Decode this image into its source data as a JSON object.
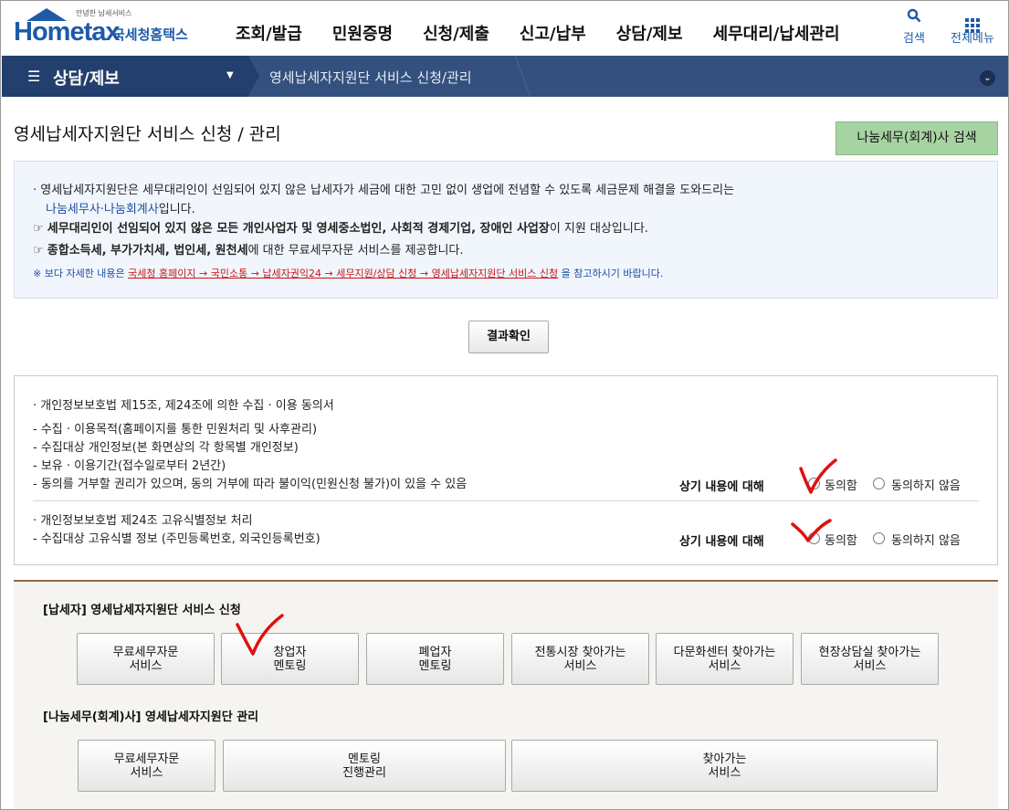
{
  "header": {
    "logo_small": "안녕한 납세서비스",
    "logo_text": "Hometax",
    "logo_sub": "국세청홈택스",
    "nav": [
      "조회/발급",
      "민원증명",
      "신청/제출",
      "신고/납부",
      "상담/제보",
      "세무대리/납세관리"
    ],
    "search_label": "검색",
    "menu_label": "전체메뉴"
  },
  "location": {
    "section": "상담/제보",
    "crumb": "영세납세자지원단 서비스 신청/관리"
  },
  "page": {
    "title": "영세납세자지원단 서비스 신청 / 관리",
    "search_button": "나눔세무(회계)사 검색"
  },
  "info": {
    "line1": "영세납세자지원단은 세무대리인이 선임되어 있지 않은 납세자가 세금에 대한 고민 없이 생업에 전념할 수 있도록 세금문제 해결을 도와드리는",
    "line1b_link": "나눔세무사·나눔회계사",
    "line1b_rest": "입니다.",
    "line2_bold1": "세무대리인이 선임되어 있지 않은 모든 개인사업자 및 영세중소법인, 사회적 경제기업, 장애인 사업장",
    "line2_rest": "이 지원 대상입니다.",
    "line3_bold": "종합소득세, 부가가치세, 법인세, 원천세",
    "line3_rest": "에 대한 무료세무자문 서비스를 제공합니다.",
    "note_prefix": "※ 보다 자세한 내용은",
    "note_link": "국세청 홈페이지 → 국민소통 → 납세자권익24 → 세무지원/상담 신청 → 영세납세자지원단 서비스 신청",
    "note_suffix": "을 참고하시기 바랍니다."
  },
  "result_button": "결과확인",
  "consent": {
    "block1": [
      "개인정보보호법 제15조,  제24조에 의한 수집 · 이용 동의서",
      "- 수집 · 이용목적(홈페이지를 통한 민원처리 및 사후관리)",
      "- 수집대상 개인정보(본 화면상의 각 항목별 개인정보)",
      "- 보유 · 이용기간(접수일로부터 2년간)",
      "- 동의를 거부할 권리가 있으며, 동의 거부에 따라 불이익(민원신청 불가)이 있을 수 있음"
    ],
    "block2": [
      "개인정보보호법 제24조 고유식별정보 처리",
      "- 수집대상 고유식별 정보 (주민등록번호, 외국인등록번호)"
    ],
    "prompt": "상기 내용에 대해",
    "agree": "동의함",
    "disagree": "동의하지 않음"
  },
  "taxpayer": {
    "heading": "[납세자]  영세납세자지원단 서비스 신청",
    "buttons": [
      "무료세무자문\n서비스",
      "창업자\n멘토링",
      "폐업자\n멘토링",
      "전통시장 찾아가는\n서비스",
      "다문화센터 찾아가는\n서비스",
      "현장상담실 찾아가는\n서비스"
    ]
  },
  "accountant": {
    "heading": "[나눔세무(회계)사]  영세납세자지원단 관리",
    "buttons": [
      "무료세무자문\n서비스",
      "멘토링\n진행관리",
      "찾아가는\n서비스"
    ]
  },
  "colors": {
    "brand": "#1e5aa8",
    "location_bar": "#34507e",
    "handwriting": "#e01010",
    "green_button": "#a7d3a3"
  }
}
